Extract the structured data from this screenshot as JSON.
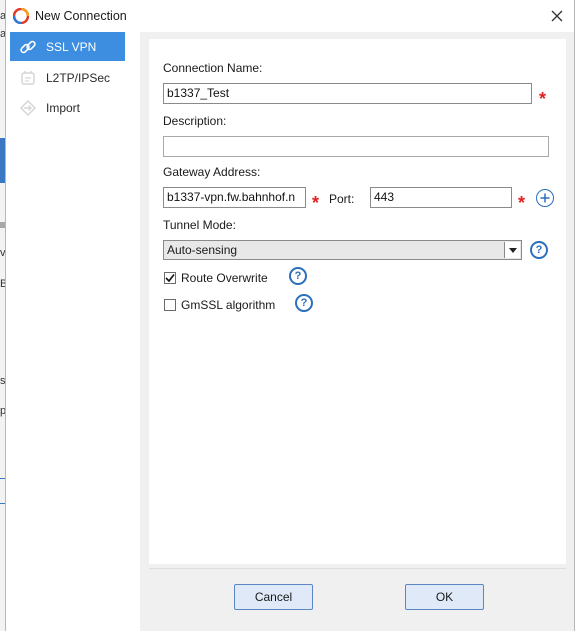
{
  "window": {
    "title": "New Connection"
  },
  "sidebar": {
    "items": [
      {
        "label": "SSL VPN",
        "icon": "link-icon",
        "active": true
      },
      {
        "label": "L2TP/IPSec",
        "icon": "l2tp-icon",
        "active": false
      },
      {
        "label": "Import",
        "icon": "import-icon",
        "active": false
      }
    ]
  },
  "form": {
    "connection_name_label": "Connection Name:",
    "connection_name_value": "b1337_Test",
    "description_label": "Description:",
    "description_value": "",
    "gateway_label": "Gateway Address:",
    "gateway_value": "b1337-vpn.fw.bahnhof.n",
    "port_label": "Port:",
    "port_value": "443",
    "tunnel_mode_label": "Tunnel Mode:",
    "tunnel_mode_value": "Auto-sensing",
    "route_overwrite_label": "Route Overwrite",
    "route_overwrite_checked": true,
    "gmssl_label": "GmSSL algorithm",
    "gmssl_checked": false,
    "required_marker": "*",
    "help_marker": "?"
  },
  "buttons": {
    "cancel": "Cancel",
    "ok": "OK"
  },
  "background_app": {
    "chars": [
      "a",
      "a",
      "v",
      "B",
      "s",
      "p"
    ]
  },
  "colors": {
    "accent": "#3d8ee0",
    "required": "#e02020",
    "help": "#2b6fbb",
    "button_bg": "#dfe9f7",
    "button_border": "#5b86c4"
  }
}
